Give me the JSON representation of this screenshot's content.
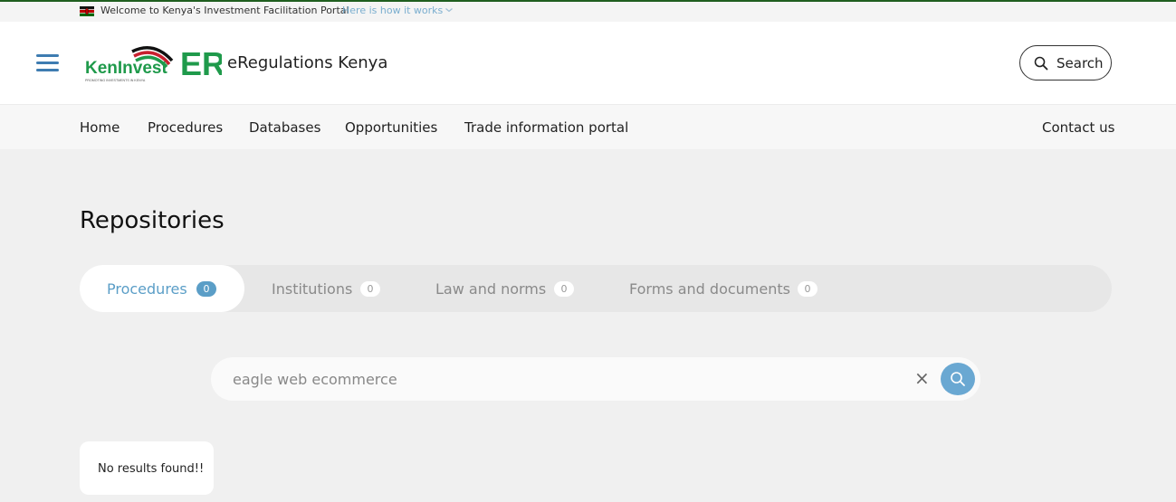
{
  "welcome": {
    "text": "Welcome to Kenya's Investment Facilitation Portal",
    "link": "Here is how it works"
  },
  "header": {
    "logo_text": "KenInvest",
    "logo_tagline": "PROMOTING INVESTMENTS IN KENYA",
    "er_text": "ER",
    "site_title": "eRegulations Kenya",
    "search_label": "Search"
  },
  "nav": {
    "items": [
      "Home",
      "Procedures",
      "Databases",
      "Opportunities",
      "Trade information portal"
    ],
    "contact": "Contact us"
  },
  "page": {
    "title": "Repositories"
  },
  "tabs": [
    {
      "label": "Procedures",
      "count": "0",
      "active": true
    },
    {
      "label": "Institutions",
      "count": "0",
      "active": false
    },
    {
      "label": "Law and norms",
      "count": "0",
      "active": false
    },
    {
      "label": "Forms and documents",
      "count": "0",
      "active": false
    }
  ],
  "search": {
    "value": "eagle web ecommerce",
    "clear_symbol": "×"
  },
  "results": {
    "message": "No results found!!"
  },
  "colors": {
    "accent": "#5b9ec7",
    "brand_green": "#1f9a4b",
    "brand_red": "#c8202f",
    "menu_blue": "#3e7cb1"
  },
  "icons": [
    "kenya-flag-icon",
    "chevron-down-icon",
    "menu-icon",
    "search-icon",
    "close-icon"
  ]
}
